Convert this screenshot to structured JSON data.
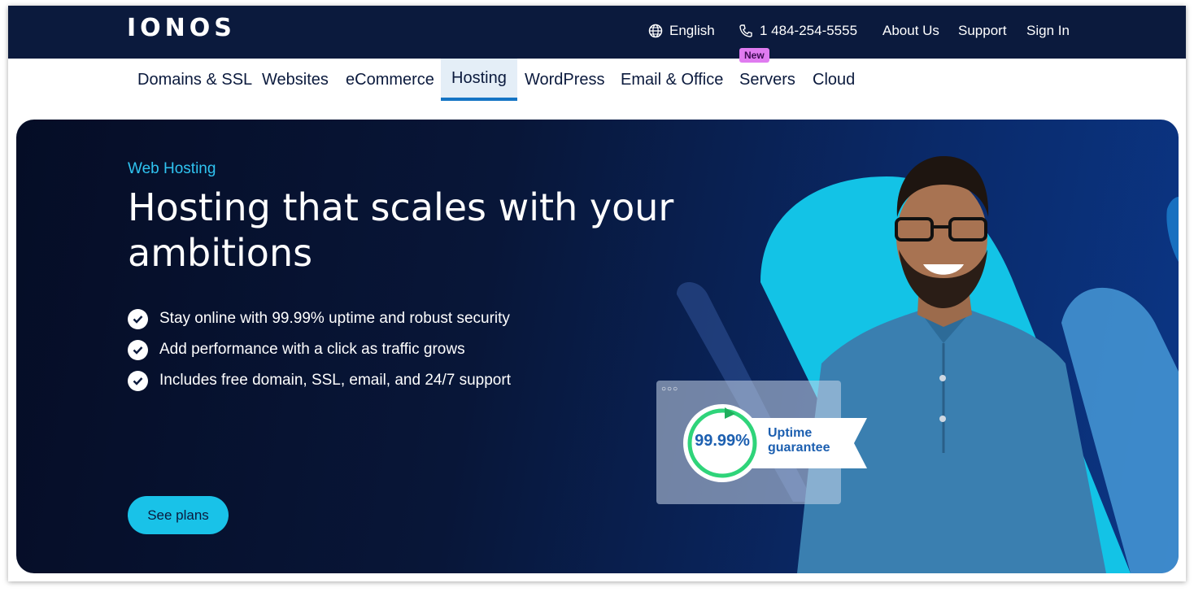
{
  "brand": {
    "logo_text": "IONOS"
  },
  "topbar": {
    "language": "English",
    "phone": "1 484-254-5555",
    "about": "About Us",
    "support": "Support",
    "signin": "Sign In"
  },
  "nav": {
    "items": [
      "Domains & SSL",
      "Websites",
      "eCommerce",
      "Hosting",
      "WordPress",
      "Email & Office",
      "Servers",
      "Cloud"
    ],
    "active": "Hosting",
    "new_badge": "New"
  },
  "hero": {
    "eyebrow": "Web Hosting",
    "headline": "Hosting that scales with your ambitions",
    "bullets": [
      "Stay online with 99.99% uptime and robust security",
      "Add performance with a click as traffic grows",
      "Includes free domain, SSL, email, and 24/7 support"
    ],
    "cta": "See plans",
    "uptime_value": "99.99%",
    "uptime_label_1": "Uptime",
    "uptime_label_2": "guarantee"
  },
  "colors": {
    "topbar_bg": "#0b1a3d",
    "accent_cyan": "#19c2e8",
    "active_underline": "#1474c4",
    "badge_new": "#e07bf0",
    "uptime_green": "#2fd47a"
  },
  "icons": {
    "language": "globe-icon",
    "phone": "phone-icon",
    "bullet": "check-circle-icon"
  }
}
